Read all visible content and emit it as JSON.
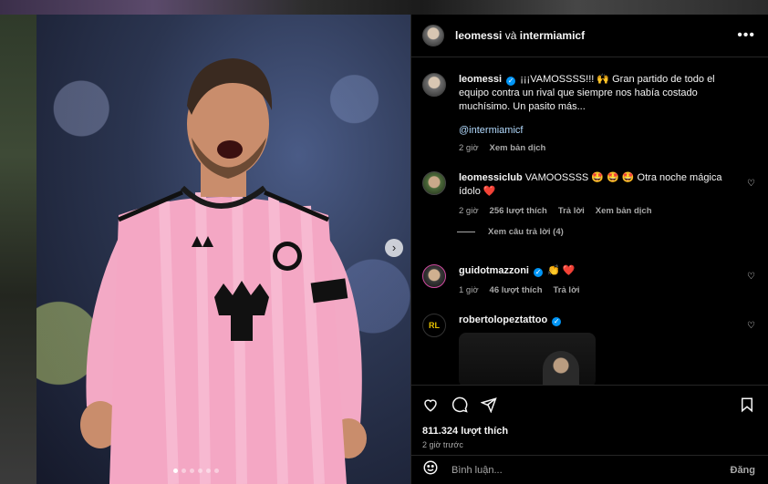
{
  "header": {
    "user1": "leomessi",
    "conjunction": "và",
    "user2": "intermiamicf"
  },
  "caption": {
    "username": "leomessi",
    "text": "¡¡¡VAMOSSSS!!! 🙌 Gran partido de todo el equipo contra un rival que siempre nos había costado muchísimo. Un pasito más...",
    "mention": "@intermiamicf",
    "time": "2 giờ",
    "translate": "Xem bản dịch"
  },
  "comments": [
    {
      "username": "leomessiclub",
      "text": "VAMOOSSSS 🤩 🤩 🤩 Otra noche mágica ídolo ❤️",
      "time": "2 giờ",
      "likes": "256 lượt thích",
      "reply": "Trả lời",
      "translate": "Xem bản dịch",
      "view_replies": "Xem câu trả lời (4)"
    },
    {
      "username": "guidotmazzoni",
      "text": "👏 ❤️",
      "time": "1 giờ",
      "likes": "46 lượt thích",
      "reply": "Trả lời"
    },
    {
      "username": "robertolopeztattoo",
      "avatar_text": "RL"
    }
  ],
  "stats": {
    "likes": "811.324 lượt thích",
    "posted": "2 giờ trước"
  },
  "comment_box": {
    "placeholder": "Bình luận...",
    "post_label": "Đăng"
  },
  "carousel": {
    "dot_count": 6,
    "active_index": 0
  },
  "colors": {
    "verified": "#0095f6",
    "background": "#000000",
    "muted_text": "#a8a8a8",
    "jersey_pink": "#f4a7c4"
  }
}
